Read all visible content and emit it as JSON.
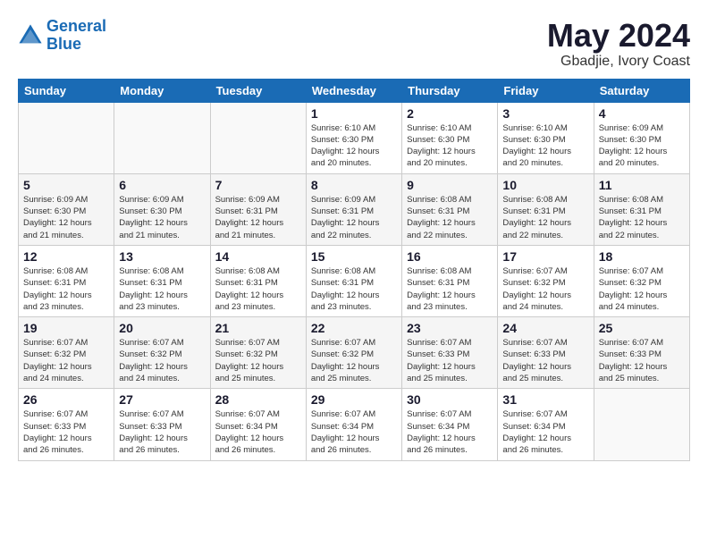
{
  "logo": {
    "line1": "General",
    "line2": "Blue"
  },
  "title": "May 2024",
  "subtitle": "Gbadjie, Ivory Coast",
  "weekdays": [
    "Sunday",
    "Monday",
    "Tuesday",
    "Wednesday",
    "Thursday",
    "Friday",
    "Saturday"
  ],
  "weeks": [
    [
      {
        "day": "",
        "info": ""
      },
      {
        "day": "",
        "info": ""
      },
      {
        "day": "",
        "info": ""
      },
      {
        "day": "1",
        "info": "Sunrise: 6:10 AM\nSunset: 6:30 PM\nDaylight: 12 hours\nand 20 minutes."
      },
      {
        "day": "2",
        "info": "Sunrise: 6:10 AM\nSunset: 6:30 PM\nDaylight: 12 hours\nand 20 minutes."
      },
      {
        "day": "3",
        "info": "Sunrise: 6:10 AM\nSunset: 6:30 PM\nDaylight: 12 hours\nand 20 minutes."
      },
      {
        "day": "4",
        "info": "Sunrise: 6:09 AM\nSunset: 6:30 PM\nDaylight: 12 hours\nand 20 minutes."
      }
    ],
    [
      {
        "day": "5",
        "info": "Sunrise: 6:09 AM\nSunset: 6:30 PM\nDaylight: 12 hours\nand 21 minutes."
      },
      {
        "day": "6",
        "info": "Sunrise: 6:09 AM\nSunset: 6:30 PM\nDaylight: 12 hours\nand 21 minutes."
      },
      {
        "day": "7",
        "info": "Sunrise: 6:09 AM\nSunset: 6:31 PM\nDaylight: 12 hours\nand 21 minutes."
      },
      {
        "day": "8",
        "info": "Sunrise: 6:09 AM\nSunset: 6:31 PM\nDaylight: 12 hours\nand 22 minutes."
      },
      {
        "day": "9",
        "info": "Sunrise: 6:08 AM\nSunset: 6:31 PM\nDaylight: 12 hours\nand 22 minutes."
      },
      {
        "day": "10",
        "info": "Sunrise: 6:08 AM\nSunset: 6:31 PM\nDaylight: 12 hours\nand 22 minutes."
      },
      {
        "day": "11",
        "info": "Sunrise: 6:08 AM\nSunset: 6:31 PM\nDaylight: 12 hours\nand 22 minutes."
      }
    ],
    [
      {
        "day": "12",
        "info": "Sunrise: 6:08 AM\nSunset: 6:31 PM\nDaylight: 12 hours\nand 23 minutes."
      },
      {
        "day": "13",
        "info": "Sunrise: 6:08 AM\nSunset: 6:31 PM\nDaylight: 12 hours\nand 23 minutes."
      },
      {
        "day": "14",
        "info": "Sunrise: 6:08 AM\nSunset: 6:31 PM\nDaylight: 12 hours\nand 23 minutes."
      },
      {
        "day": "15",
        "info": "Sunrise: 6:08 AM\nSunset: 6:31 PM\nDaylight: 12 hours\nand 23 minutes."
      },
      {
        "day": "16",
        "info": "Sunrise: 6:08 AM\nSunset: 6:31 PM\nDaylight: 12 hours\nand 23 minutes."
      },
      {
        "day": "17",
        "info": "Sunrise: 6:07 AM\nSunset: 6:32 PM\nDaylight: 12 hours\nand 24 minutes."
      },
      {
        "day": "18",
        "info": "Sunrise: 6:07 AM\nSunset: 6:32 PM\nDaylight: 12 hours\nand 24 minutes."
      }
    ],
    [
      {
        "day": "19",
        "info": "Sunrise: 6:07 AM\nSunset: 6:32 PM\nDaylight: 12 hours\nand 24 minutes."
      },
      {
        "day": "20",
        "info": "Sunrise: 6:07 AM\nSunset: 6:32 PM\nDaylight: 12 hours\nand 24 minutes."
      },
      {
        "day": "21",
        "info": "Sunrise: 6:07 AM\nSunset: 6:32 PM\nDaylight: 12 hours\nand 25 minutes."
      },
      {
        "day": "22",
        "info": "Sunrise: 6:07 AM\nSunset: 6:32 PM\nDaylight: 12 hours\nand 25 minutes."
      },
      {
        "day": "23",
        "info": "Sunrise: 6:07 AM\nSunset: 6:33 PM\nDaylight: 12 hours\nand 25 minutes."
      },
      {
        "day": "24",
        "info": "Sunrise: 6:07 AM\nSunset: 6:33 PM\nDaylight: 12 hours\nand 25 minutes."
      },
      {
        "day": "25",
        "info": "Sunrise: 6:07 AM\nSunset: 6:33 PM\nDaylight: 12 hours\nand 25 minutes."
      }
    ],
    [
      {
        "day": "26",
        "info": "Sunrise: 6:07 AM\nSunset: 6:33 PM\nDaylight: 12 hours\nand 26 minutes."
      },
      {
        "day": "27",
        "info": "Sunrise: 6:07 AM\nSunset: 6:33 PM\nDaylight: 12 hours\nand 26 minutes."
      },
      {
        "day": "28",
        "info": "Sunrise: 6:07 AM\nSunset: 6:34 PM\nDaylight: 12 hours\nand 26 minutes."
      },
      {
        "day": "29",
        "info": "Sunrise: 6:07 AM\nSunset: 6:34 PM\nDaylight: 12 hours\nand 26 minutes."
      },
      {
        "day": "30",
        "info": "Sunrise: 6:07 AM\nSunset: 6:34 PM\nDaylight: 12 hours\nand 26 minutes."
      },
      {
        "day": "31",
        "info": "Sunrise: 6:07 AM\nSunset: 6:34 PM\nDaylight: 12 hours\nand 26 minutes."
      },
      {
        "day": "",
        "info": ""
      }
    ]
  ]
}
